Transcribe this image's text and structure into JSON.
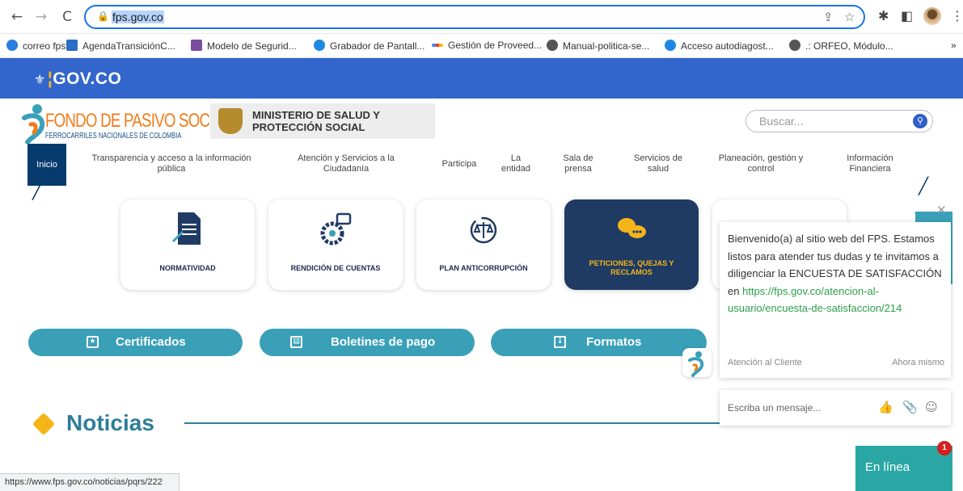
{
  "browser": {
    "url": "fps.gov.co",
    "back": "←",
    "forward": "→",
    "reload": "C",
    "bookmarks": [
      "correo fps",
      "AgendaTransiciónC...",
      "Modelo de Segurid...",
      "Grabador de Pantall...",
      "Gestión de Proveed...",
      "Manual-politica-se...",
      "Acceso autodiagost...",
      ".: ORFEO, Módulo..."
    ],
    "more": "»",
    "status_url": "https://www.fps.gov.co/noticias/pqrs/222"
  },
  "gov": {
    "logo": "GOV.CO"
  },
  "header": {
    "fps_name": "FONDO DE PASIVO SOCIAL",
    "fps_sub": "FERROCARRILES NACIONALES DE COLOMBIA",
    "ministry_line1": "MINISTERIO DE SALUD Y",
    "ministry_line2": "PROTECCIÓN SOCIAL",
    "search_placeholder": "Buscar..."
  },
  "nav": [
    "Inicio",
    "Transparencia y acceso a la información pública",
    "Atención y Servicios a la Ciudadanía",
    "Participa",
    "La entidad",
    "Sala de prensa",
    "Servicios de salud",
    "Planeación, gestión y control",
    "Información Financiera"
  ],
  "cards": [
    "NORMATIVIDAD",
    "RENDICIÓN DE CUENTAS",
    "PLAN ANTICORRUPCIÓN",
    "PETICIONES, QUEJAS Y RECLAMOS"
  ],
  "buttons": [
    "Certificados",
    "Boletines de pago",
    "Formatos"
  ],
  "section_title": "Noticias",
  "chat": {
    "message_text": "Bienvenido(a) al sitio web del FPS. Estamos listos para atender tus dudas y te invitamos a diligenciar la ENCUESTA DE SATISFACCIÓN en",
    "message_link": "https://fps.gov.co/atencion-al-usuario/encuesta-de-satisfaccion/214",
    "sender": "Atención al Cliente",
    "time": "Ahora mismo",
    "input_placeholder": "Escriba un mensaje...",
    "status": "En línea",
    "badge": "1"
  },
  "colors": {
    "gov_blue": "#3366cc",
    "nav_dark": "#073b6d",
    "teal": "#3aa0b8",
    "orange": "#f07b1a",
    "gold": "#f5b51a"
  }
}
